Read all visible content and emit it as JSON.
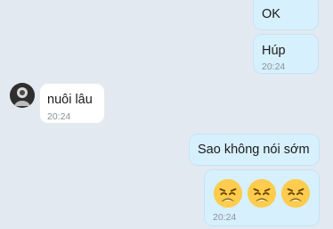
{
  "messages": [
    {
      "id": "ok",
      "direction": "outgoing",
      "text": "OK",
      "time": ""
    },
    {
      "id": "hup",
      "direction": "outgoing",
      "text": "Húp",
      "time": "20:24"
    },
    {
      "id": "nuoi",
      "direction": "incoming",
      "text": "nuôi lâu",
      "time": "20:24"
    },
    {
      "id": "sao",
      "direction": "outgoing",
      "text": "Sao không nói sớm",
      "time": ""
    },
    {
      "id": "emoji",
      "direction": "outgoing",
      "emojis": [
        "weary-face",
        "weary-face",
        "weary-face"
      ],
      "time": "20:24"
    }
  ],
  "colors": {
    "background": "#e2e9f1",
    "outgoing_bubble": "#d7f0fd",
    "incoming_bubble": "#ffffff",
    "timestamp": "#8a9299"
  }
}
